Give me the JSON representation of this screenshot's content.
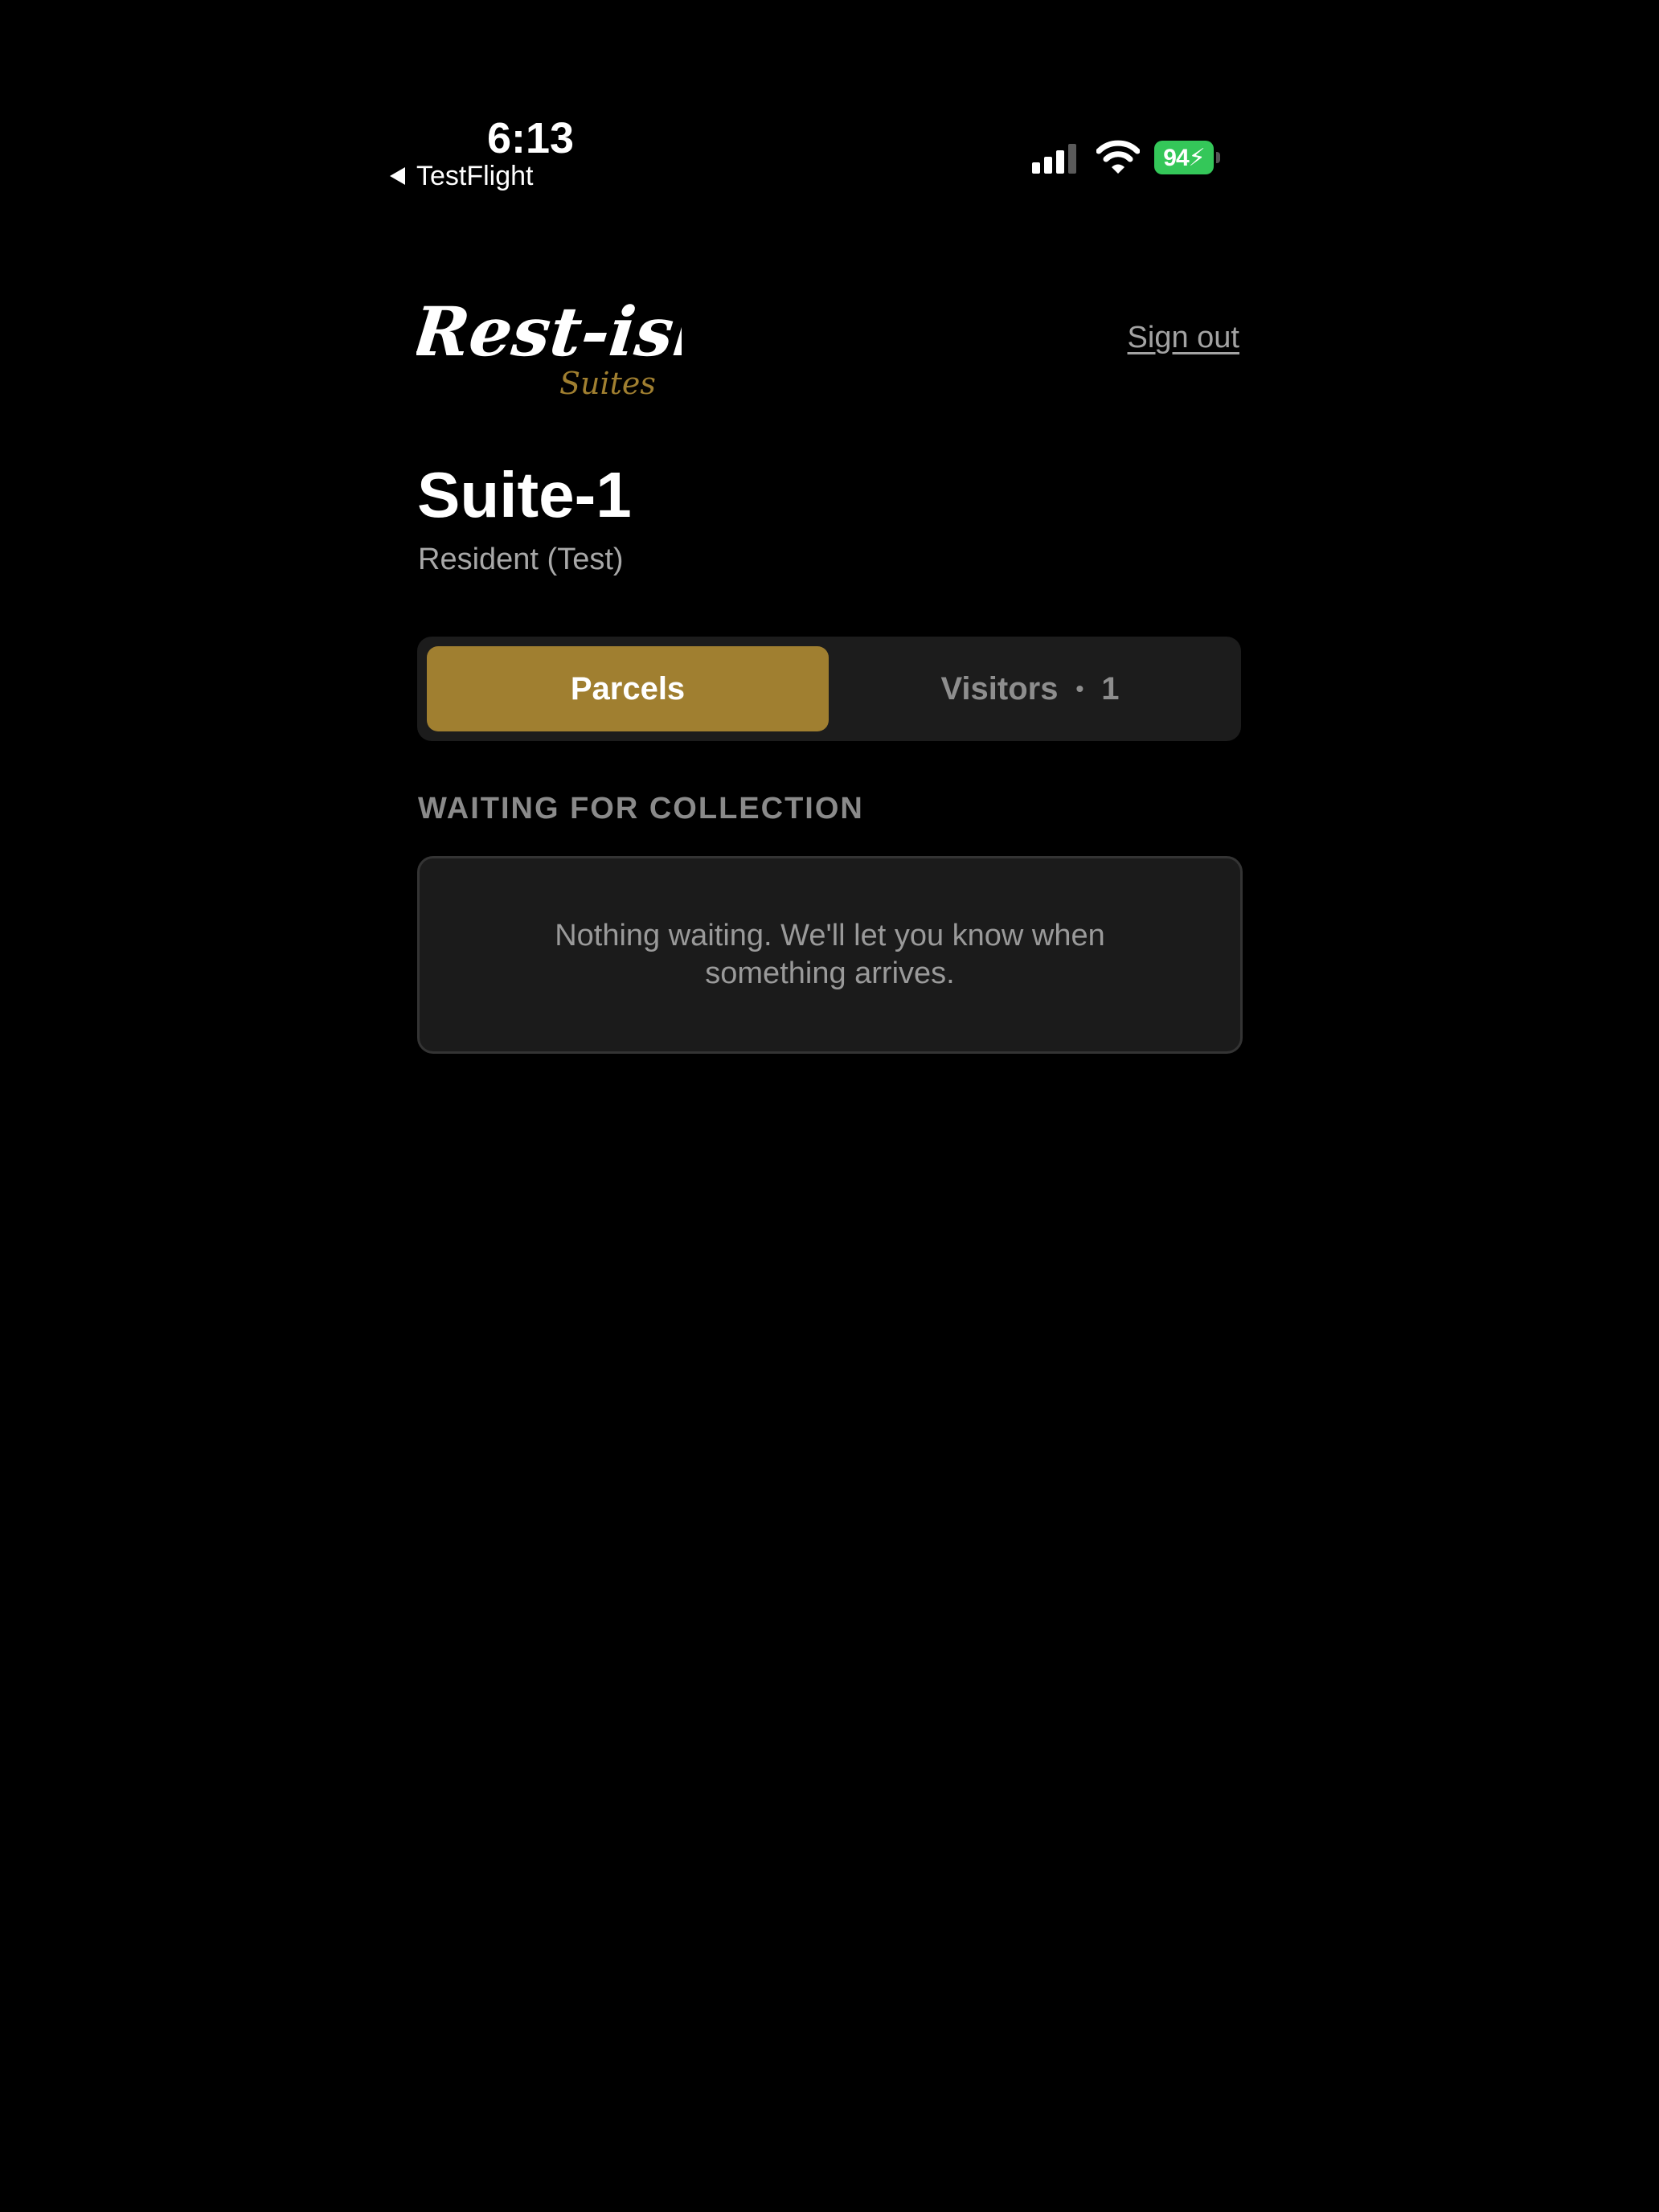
{
  "status_bar": {
    "time": "6:13",
    "back_app": "TestFlight",
    "battery": "94"
  },
  "header": {
    "logo_main": "Rest-isle",
    "logo_sub": "Suites",
    "sign_out_label": "Sign out"
  },
  "suite": {
    "title": "Suite-1",
    "subtitle": "Resident (Test)"
  },
  "tabs": {
    "parcels_label": "Parcels",
    "visitors_label": "Visitors",
    "visitors_separator": "•",
    "visitors_count": "1",
    "active": "Parcels"
  },
  "section": {
    "heading": "WAITING FOR COLLECTION",
    "empty_message": "Nothing waiting. We'll let you know when something arrives."
  },
  "colors": {
    "background": "#000000",
    "accent": "#a07f30",
    "battery": "#34c759"
  }
}
